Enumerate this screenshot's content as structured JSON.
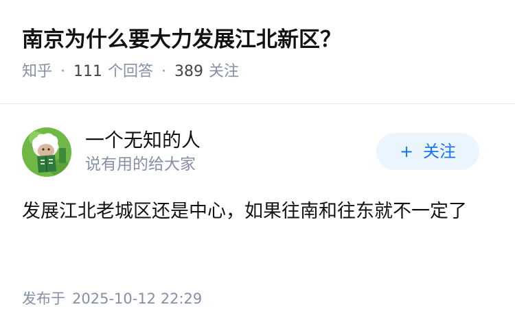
{
  "question": {
    "title": "南京为什么要大力发展江北新区？",
    "source": "知乎",
    "separator": "·",
    "answer_count": "111",
    "answer_label": "个回答",
    "follower_count": "389",
    "follower_label": "关注"
  },
  "author": {
    "name": "一个无知的人",
    "bio": "说有用的给大家",
    "avatar_icon": "cartoon-reader-avatar-icon"
  },
  "follow_button": {
    "icon": "plus-icon",
    "plus_glyph": "+",
    "label": "关注"
  },
  "answer": {
    "text": "发展江北老城区还是中心，如果往南和往东就不一定了"
  },
  "publish": {
    "label": "发布于",
    "time": "2025-10-12 22:29"
  },
  "colors": {
    "meta_gray": "#8590a6",
    "follow_blue": "#1772f6",
    "follow_bg": "#ebf5fd",
    "text_dark": "#121212"
  }
}
